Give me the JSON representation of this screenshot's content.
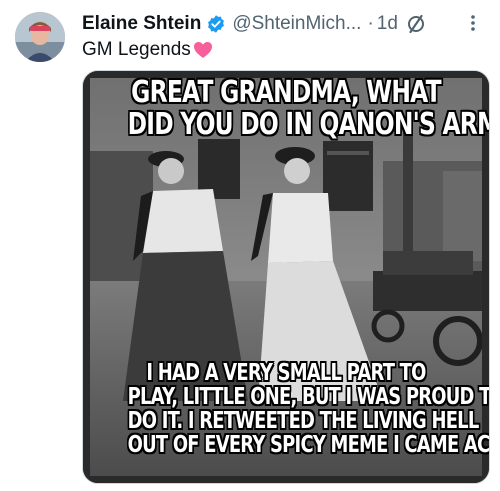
{
  "tweet": {
    "author_name": "Elaine Shtein",
    "handle": "@ShteinMich...",
    "separator": "·",
    "time": "1d",
    "text": "GM Legends",
    "text_emoji": "pink-heart",
    "verified_color": "#1d9bf0",
    "heart_color": "#f7609b"
  },
  "meme": {
    "top_lines": [
      "GREAT GRANDMA, WHAT",
      "DID YOU DO IN QANON'S ARMY?"
    ],
    "bottom_lines": [
      "I HAD A VERY SMALL PART TO",
      "PLAY, LITTLE ONE, BUT I WAS PROUD TO",
      "DO IT. I RETWEETED THE LIVING HELL",
      "OUT OF EVERY SPICY MEME I CAME ACROSS."
    ]
  },
  "icons": {
    "verified": "verified-badge-icon",
    "grok": "grok-icon",
    "more": "more-options-icon"
  }
}
